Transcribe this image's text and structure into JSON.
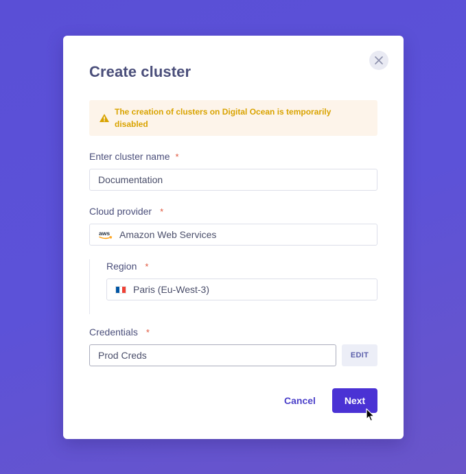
{
  "dialog": {
    "title": "Create cluster",
    "alert": "The creation of clusters on Digital Ocean is temporarily disabled"
  },
  "fields": {
    "cluster_name": {
      "label": "Enter cluster name",
      "required": "*",
      "value": "Documentation"
    },
    "cloud_provider": {
      "label": "Cloud provider",
      "required": "*",
      "value": "Amazon Web Services",
      "icon": "aws-logo"
    },
    "region": {
      "label": "Region",
      "required": "*",
      "value": "Paris (Eu-West-3)",
      "icon": "france-flag-icon"
    },
    "credentials": {
      "label": "Credentials",
      "required": "*",
      "value": "Prod Creds",
      "edit_label": "EDIT"
    }
  },
  "actions": {
    "cancel": "Cancel",
    "next": "Next"
  },
  "colors": {
    "background": "#5a4fd6",
    "primary": "#4a32d4",
    "warning_text": "#d9a300",
    "warning_bg": "#fdf4ea",
    "required": "#e0573e"
  }
}
